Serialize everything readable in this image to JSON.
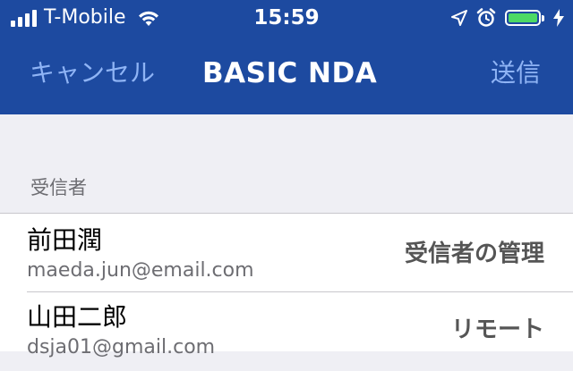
{
  "status_bar": {
    "carrier": "T-Mobile",
    "time": "15:59",
    "signal_bars": 4,
    "battery_level": 1.0,
    "battery_color": "#4cd964",
    "icons": [
      "wifi-icon",
      "location-arrow-icon",
      "alarm-icon",
      "battery-icon",
      "charging-bolt-icon"
    ]
  },
  "nav": {
    "cancel_label": "キャンセル",
    "title": "BASIC NDA",
    "send_label": "送信",
    "bar_color": "#1d4aa0",
    "button_color": "#8fb4f5"
  },
  "section": {
    "header": "受信者"
  },
  "recipients": [
    {
      "name": "前田潤",
      "email": "maeda.jun@email.com",
      "action": "受信者の管理"
    },
    {
      "name": "山田二郎",
      "email": "dsja01@gmail.com",
      "action": "リモート"
    }
  ]
}
